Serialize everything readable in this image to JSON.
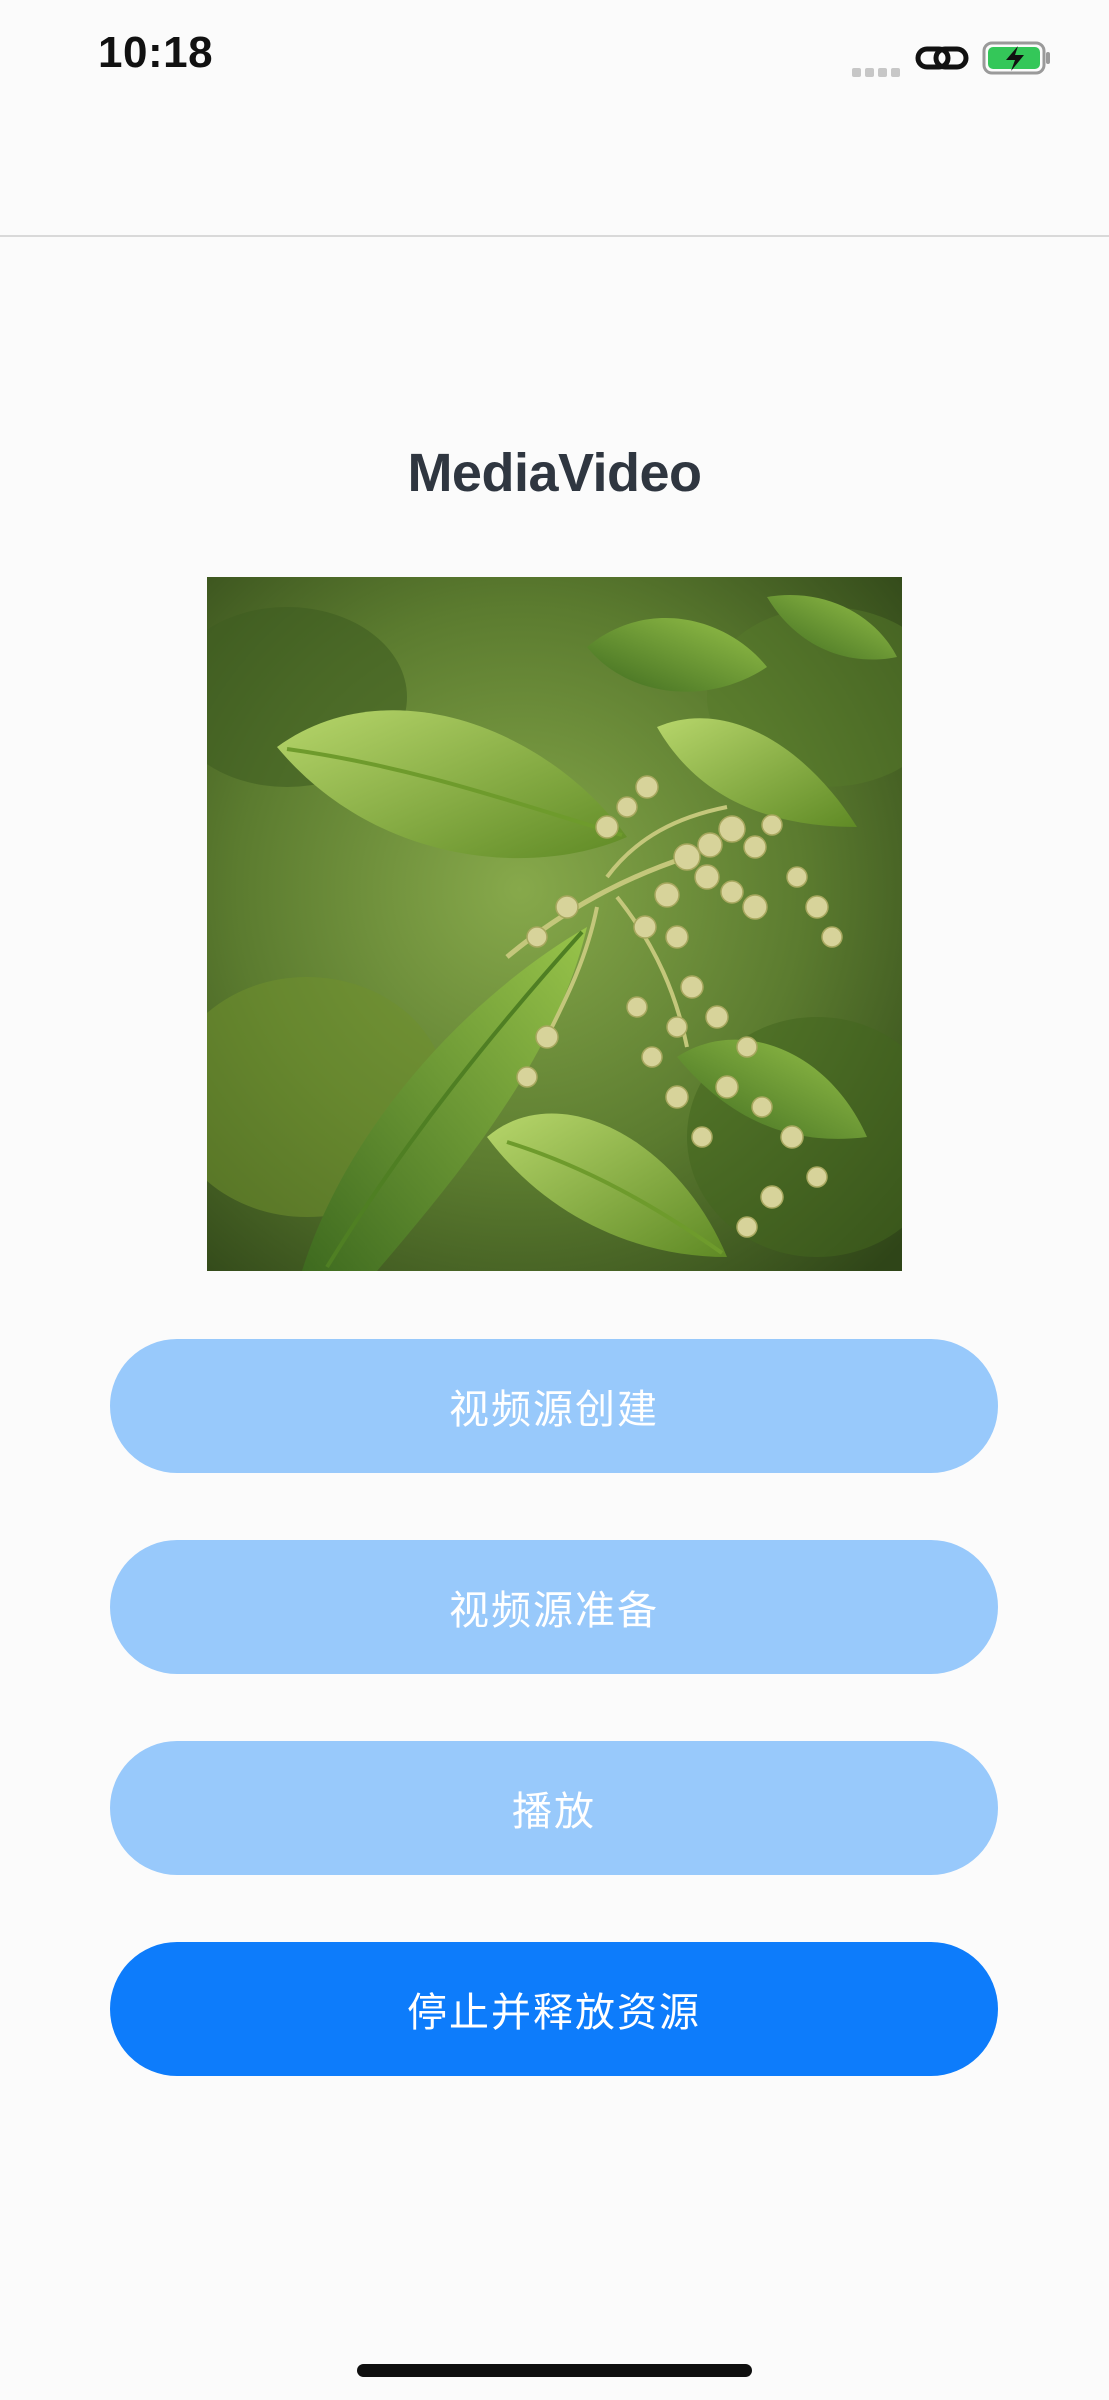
{
  "status_bar": {
    "time": "10:18",
    "icons": [
      "signal-icon",
      "link-icon",
      "battery-charging-icon"
    ],
    "battery_color": "#34c759"
  },
  "page": {
    "title": "MediaVideo"
  },
  "video": {
    "icon": "video-preview"
  },
  "buttons": [
    {
      "label": "视频源创建",
      "enabled": false
    },
    {
      "label": "视频源准备",
      "enabled": false
    },
    {
      "label": "播放",
      "enabled": false
    },
    {
      "label": "停止并释放资源",
      "enabled": true
    }
  ],
  "colors": {
    "accent": "#0d7cfb",
    "accent_disabled": "#98c9fb",
    "title": "#2f3640",
    "background": "#fbfbfb"
  }
}
